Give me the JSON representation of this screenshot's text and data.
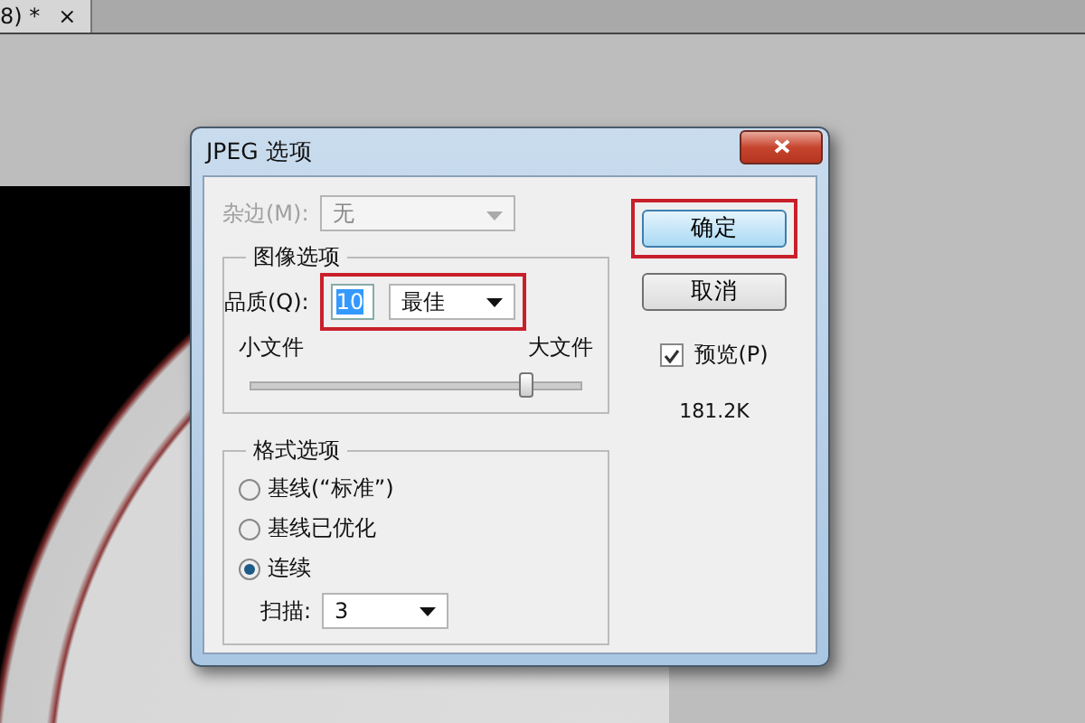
{
  "document_tab": {
    "title": "8) *",
    "close": "×"
  },
  "dialog": {
    "title": "JPEG 选项",
    "matte": {
      "label": "杂边(M):",
      "value": "无",
      "disabled": true
    },
    "image_options": {
      "title": "图像选项",
      "quality_label": "品质(Q):",
      "quality_value": "10",
      "quality_value_selected": true,
      "quality_preset": "最佳",
      "highlighted": true,
      "min_label": "小文件",
      "max_label": "大文件",
      "level": 0.83
    },
    "format_options": {
      "title": "格式选项",
      "choices": [
        {
          "label": "基线(“标准”)",
          "selected": false
        },
        {
          "label": "基线已优化",
          "selected": false
        },
        {
          "label": "连续",
          "selected": true
        }
      ],
      "scans_label": "扫描:",
      "scans_value": "3"
    },
    "buttons": [
      {
        "label": "确定",
        "default": true,
        "highlighted": true
      },
      {
        "label": "取消",
        "default": false,
        "highlighted": false
      }
    ],
    "preview": {
      "label": "预览(P)",
      "checked": true
    },
    "file_size": "181.2K"
  }
}
